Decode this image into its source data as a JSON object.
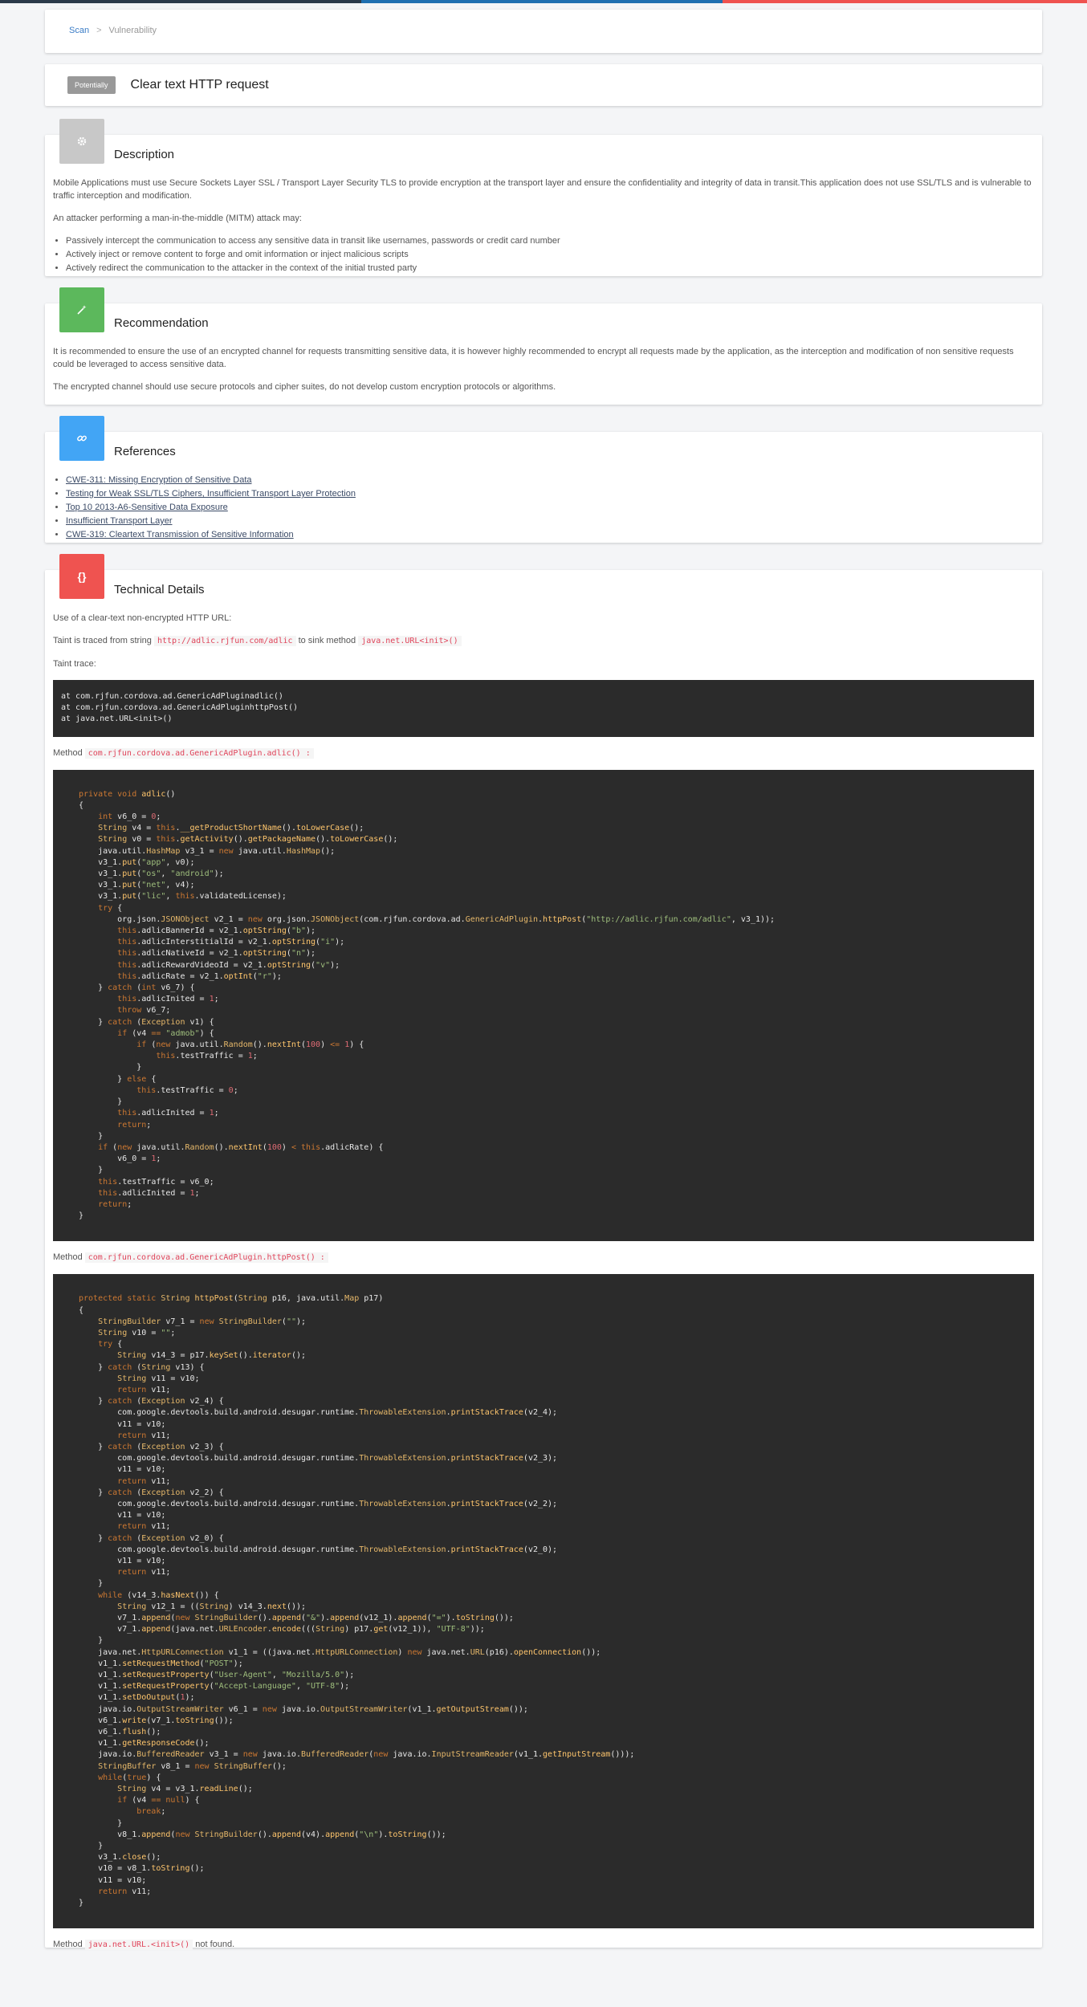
{
  "breadcrumb": {
    "scan": "Scan",
    "separator": ">",
    "current": "Vulnerability"
  },
  "title": {
    "badge": "Potentially",
    "text": "Clear text HTTP request"
  },
  "description": {
    "heading": "Description",
    "icon": "gear-icon",
    "para1": "Mobile Applications must use Secure Sockets Layer SSL / Transport Layer Security TLS to provide encryption at the transport layer and ensure the confidentiality and integrity of data in transit.This application does not use SSL/TLS and is vulnerable to traffic interception and modification.",
    "para2": "An attacker performing a man-in-the-middle (MITM) attack may:",
    "bullets": [
      "Passively intercept the communication to access any sensitive data in transit like usernames, passwords or credit card number",
      "Actively inject or remove content to forge and omit information or inject malicious scripts",
      "Actively redirect the communication to the attacker in the context of the initial trusted party"
    ]
  },
  "recommendation": {
    "heading": "Recommendation",
    "icon": "magic-wand-icon",
    "para1": "It is recommended to ensure the use of an encrypted channel for requests transmitting sensitive data, it is however highly recommended to encrypt all requests made by the application, as the interception and modification of non sensitive requests could be leveraged to access sensitive data.",
    "para2": "The encrypted channel should use secure protocols and cipher suites, do not develop custom encryption protocols or algorithms."
  },
  "references": {
    "heading": "References",
    "icon": "link-icon",
    "links": [
      "CWE-311: Missing Encryption of Sensitive Data",
      "Testing for Weak SSL/TLS Ciphers, Insufficient Transport Layer Protection",
      "Top 10 2013-A6-Sensitive Data Exposure",
      "Insufficient Transport Layer",
      "CWE-319: Cleartext Transmission of Sensitive Information"
    ]
  },
  "technical": {
    "heading": "Technical Details",
    "icon": "braces-icon",
    "intro": "Use of a clear-text non-encrypted HTTP URL:",
    "taint_prefix": "Taint is traced from string",
    "taint_url": "http://adlic.rjfun.com/adlic",
    "taint_mid": "to sink method",
    "taint_sink": "java.net.URL<init>()",
    "trace_label": "Taint trace:",
    "trace_lines": [
      "at com.rjfun.cordova.ad.GenericAdPluginadlic()",
      "at com.rjfun.cordova.ad.GenericAdPluginhttpPost()",
      "at java.net.URL<init>()"
    ],
    "method1_label": "Method",
    "method1_name": "com.rjfun.cordova.ad.GenericAdPlugin.adlic() :",
    "method2_label": "Method",
    "method2_name": "com.rjfun.cordova.ad.GenericAdPlugin.httpPost() :",
    "method3_label": "Method",
    "method3_name": "java.net.URL.<init>()",
    "method3_suffix": "not found."
  },
  "colors": {
    "description": "#c8c8c8",
    "recommendation": "#5cb85c",
    "references": "#42a5f5",
    "technical": "#ef5350",
    "topbar_blue": "#1f6fb0",
    "topbar_red": "#ef5350"
  }
}
